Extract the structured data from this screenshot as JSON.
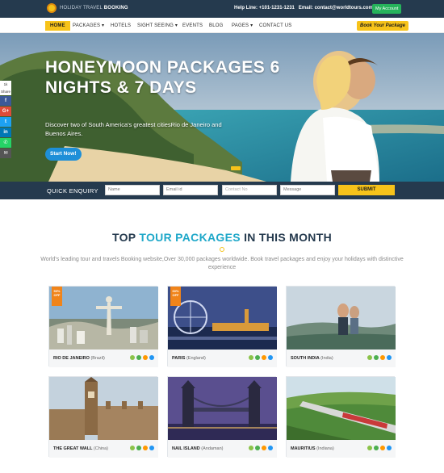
{
  "topbar": {
    "logo_light": "HOLIDAY TRAVEL ",
    "logo_bold": "BOOKING",
    "help_label": "Help Line: ",
    "help_phone": "+101-1231-1231",
    "email_label": "Email: ",
    "email": "contact@worldtours.com",
    "account_label": "My Account"
  },
  "nav": {
    "items": [
      "HOME",
      "PACKAGES ▾",
      "HOTELS",
      "SIGHT SEEING ▾",
      "EVENTS",
      "BLOG",
      "PAGES ▾",
      "CONTACT US"
    ],
    "book_label": "Book Your Package"
  },
  "hero": {
    "title": "HONEYMOON PACKAGES 6 NIGHTS & 7 DAYS",
    "subtitle": "Discover two of South America's greatest citiesRio de Janeiro and Buenos Aires.",
    "cta": "Start Now!"
  },
  "share": {
    "count": "1k",
    "label": "Share",
    "buttons": [
      {
        "icon": "facebook-icon",
        "glyph": "f",
        "color": "#3b5998"
      },
      {
        "icon": "google-plus-icon",
        "glyph": "G+",
        "color": "#dd4b39"
      },
      {
        "icon": "twitter-icon",
        "glyph": "t",
        "color": "#1da1f2"
      },
      {
        "icon": "linkedin-icon",
        "glyph": "in",
        "color": "#0077b5"
      },
      {
        "icon": "whatsapp-icon",
        "glyph": "✆",
        "color": "#25d366"
      },
      {
        "icon": "email-icon",
        "glyph": "✉",
        "color": "#555555"
      }
    ]
  },
  "enquiry": {
    "title": "QUICK ENQUIRY",
    "name_placeholder": "Name",
    "email_placeholder": "Email id",
    "contact_placeholder": "Contact No",
    "message_placeholder": "Message",
    "submit_label": "SUBMIT"
  },
  "section": {
    "title_part1": "TOP ",
    "title_highlight": "TOUR PACKAGES",
    "title_part2": " IN THIS MONTH",
    "description": "World's leading tour and travels Booking website,Over 30,000 packages worldwide. Book travel packages and enjoy your holidays with distinctive experience"
  },
  "packages": [
    {
      "name": "RIO DE JANEIRO",
      "region": "(Brazil)",
      "ribbon": "50% OFF"
    },
    {
      "name": "PARIS",
      "region": "(England)",
      "ribbon": "60% OFF"
    },
    {
      "name": "SOUTH INDIA",
      "region": "(India)",
      "ribbon": ""
    },
    {
      "name": "THE GREAT WALL",
      "region": "(China)",
      "ribbon": ""
    },
    {
      "name": "NAIL ISLAND",
      "region": "(Andaman)",
      "ribbon": ""
    },
    {
      "name": "MAURITIUS",
      "region": "(Indiana)",
      "ribbon": ""
    }
  ],
  "colors": {
    "navy": "#253a4e",
    "accent": "#f7c31a",
    "highlight": "#1fa8c9",
    "green": "#26b35b"
  }
}
